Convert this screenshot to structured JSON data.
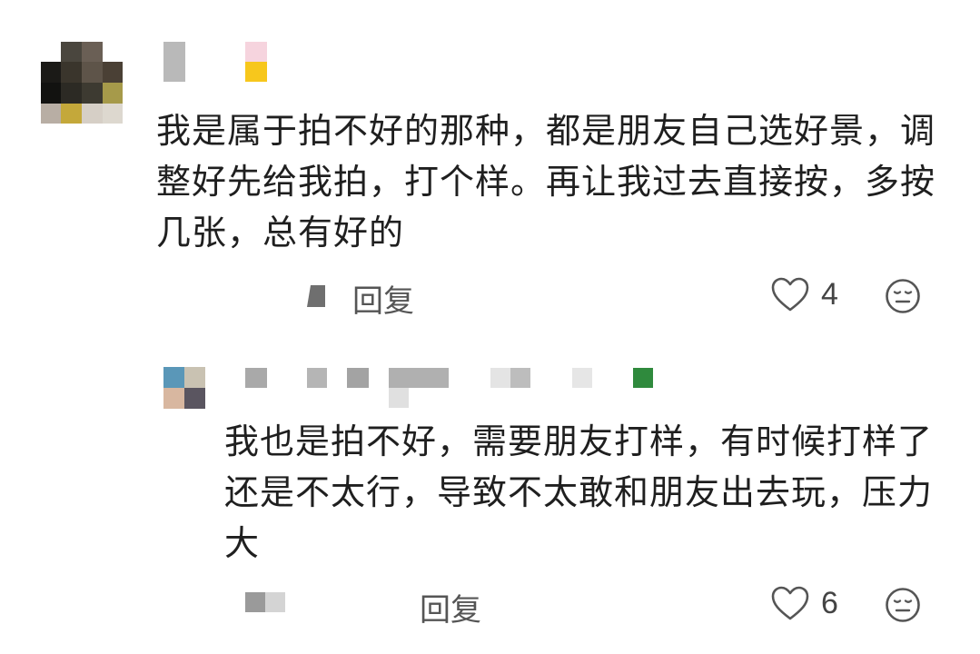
{
  "comments": [
    {
      "avatar_icon": "pixelated-avatar",
      "username_icon": "blurred-username",
      "text": "我是属于拍不好的那种，都是朋友自己选好景，调整好先给我拍，打个样。再让我过去直接按，多按几张，总有好的",
      "reply_label": "回复",
      "like_count": "4",
      "like_icon": "heart-outline-icon",
      "reaction_icon": "neutral-face-icon"
    },
    {
      "avatar_icon": "pixelated-avatar",
      "username_icon": "blurred-username",
      "text": "我也是拍不好，需要朋友打样，有时候打样了还是不太行，导致不太敢和朋友出去玩，压力大",
      "reply_label": "回复",
      "like_count": "6",
      "like_icon": "heart-outline-icon",
      "reaction_icon": "neutral-face-icon"
    }
  ],
  "colors": {
    "text": "#1f1f1f",
    "secondary_text": "#555555",
    "icon_stroke": "#555555"
  }
}
